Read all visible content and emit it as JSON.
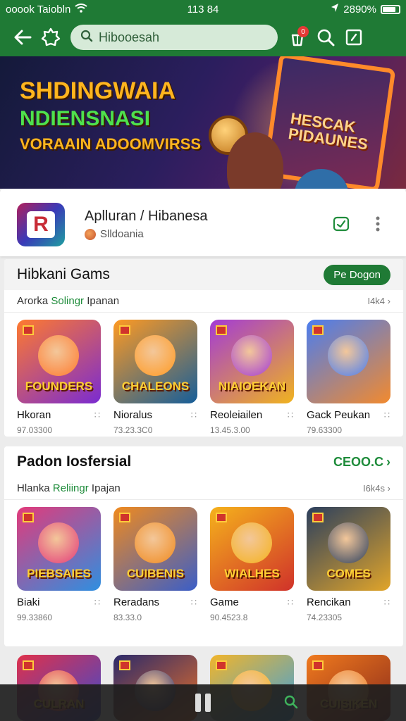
{
  "status_bar": {
    "carrier": "ooook Taiobln",
    "time": "113 84",
    "battery": "2890%"
  },
  "search": {
    "placeholder": "Hibooesah"
  },
  "notification": {
    "badge": "0"
  },
  "banner": {
    "line1": "SHDINGWAIA",
    "line2": "NDIENSNASI",
    "line3": "VORAAIN ADOOMVIRSS",
    "panel_title": "HESCAK PIDAUNES"
  },
  "app": {
    "title": "Aplluran / Hibanesa",
    "subtitle": "Slldoania"
  },
  "section1": {
    "title": "Hibkani Gams",
    "button": "Pe Dogon",
    "sub_prefix": "Arorka",
    "sub_highlight": "Solingr",
    "sub_suffix": "Ipanan",
    "count": "I4k4",
    "tiles": [
      {
        "name": "Hkoran",
        "count": "97.03300",
        "wordmark": "FOUNDERS",
        "colors": [
          "#ff7a2e",
          "#7a2bd1"
        ]
      },
      {
        "name": "Nioralus",
        "count": "73.23.3C0",
        "wordmark": "CHALEONS",
        "colors": [
          "#ff9a22",
          "#155e9a"
        ]
      },
      {
        "name": "Reoleiailen",
        "count": "13.45.3.00",
        "wordmark": "NIAIOEKAN",
        "colors": [
          "#a33bd6",
          "#f0b31e"
        ]
      },
      {
        "name": "Gack Peukan",
        "count": "79.63300",
        "wordmark": "",
        "colors": [
          "#4a7df0",
          "#f28a2e"
        ]
      }
    ]
  },
  "section2": {
    "title": "Padon Iosfersial",
    "see_more": "CEOO.C",
    "sub_prefix": "Hlanka",
    "sub_highlight": "Reliingr",
    "sub_suffix": "Ipajan",
    "count": "I6k4s",
    "tiles": [
      {
        "name": "Biaki",
        "count": "99.33860",
        "wordmark": "PIEBSAIES",
        "colors": [
          "#e33a7a",
          "#2f8fe0"
        ]
      },
      {
        "name": "Reradans",
        "count": "83.33.0",
        "wordmark": "CUIBENIS",
        "colors": [
          "#f08a1e",
          "#3a5ec8"
        ]
      },
      {
        "name": "Game",
        "count": "90.4523.8",
        "wordmark": "WIALHES",
        "colors": [
          "#f5b21c",
          "#d0322a"
        ]
      },
      {
        "name": "Rencikan",
        "count": "74.23305",
        "wordmark": "COMES",
        "colors": [
          "#2b3f5e",
          "#e1a52a"
        ]
      }
    ]
  },
  "partial_tiles": [
    {
      "wordmark": "CULRAN",
      "colors": [
        "#e0304a",
        "#3a4bd0"
      ]
    },
    {
      "wordmark": "",
      "colors": [
        "#2b2a6a",
        "#e8702a"
      ]
    },
    {
      "wordmark": "",
      "colors": [
        "#f2b52a",
        "#3aa0e0"
      ]
    },
    {
      "wordmark": "CUISIKEN",
      "colors": [
        "#f07a1e",
        "#8a2a1a"
      ]
    }
  ]
}
